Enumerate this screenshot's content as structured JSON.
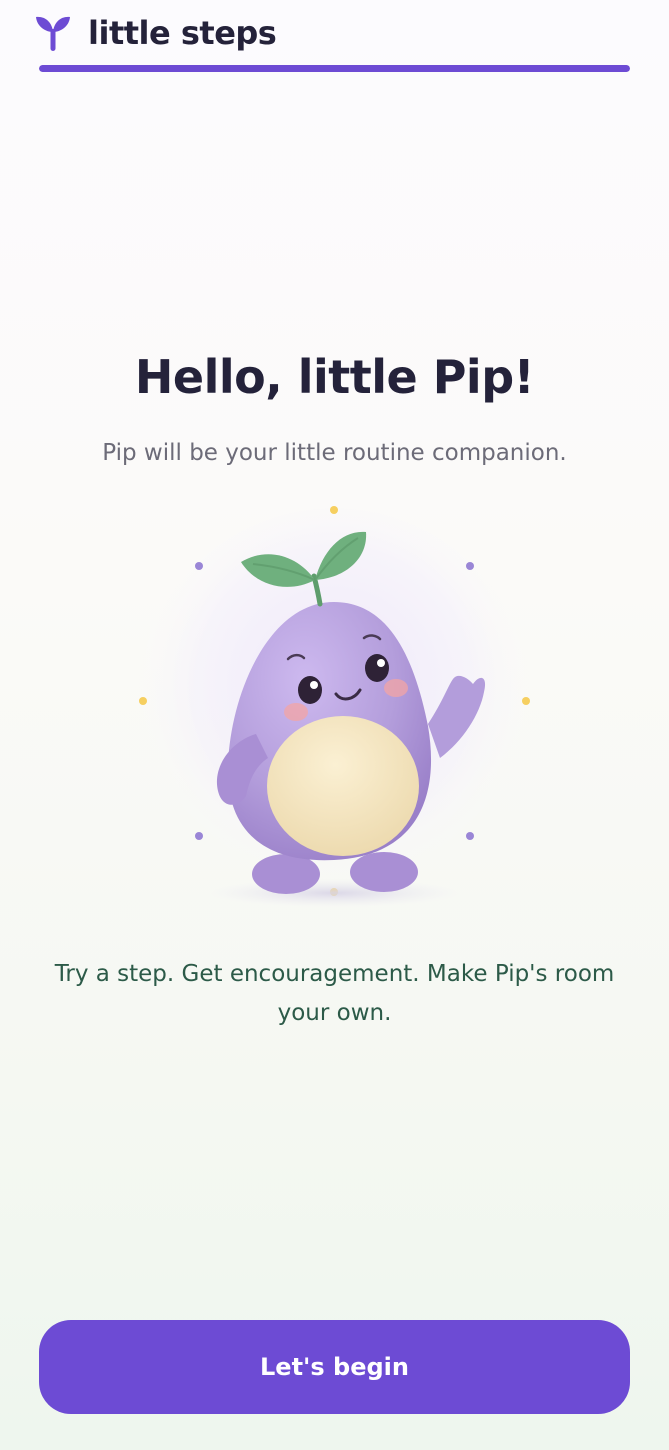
{
  "header": {
    "app_name": "little steps",
    "logo_icon": "sprout-icon",
    "progress": 1.0
  },
  "main": {
    "title": "Hello, little Pip!",
    "subtitle": "Pip will be your little routine companion.",
    "mascot_icon": "pip-mascot-illustration",
    "tagline": "Try a step. Get encouragement. Make Pip's room your own."
  },
  "actions": {
    "begin_label": "Let's begin"
  },
  "colors": {
    "accent": "#6d4bd4",
    "title_text": "#24223a",
    "subtitle_text": "#6c6b78",
    "tagline_text": "#2c5a48",
    "mascot_body": "#b39ddb",
    "mascot_belly": "#f3e2bc",
    "leaf": "#6fb07e",
    "sparkle_gold": "#f6cf60",
    "sparkle_purple": "#9a86d6"
  }
}
